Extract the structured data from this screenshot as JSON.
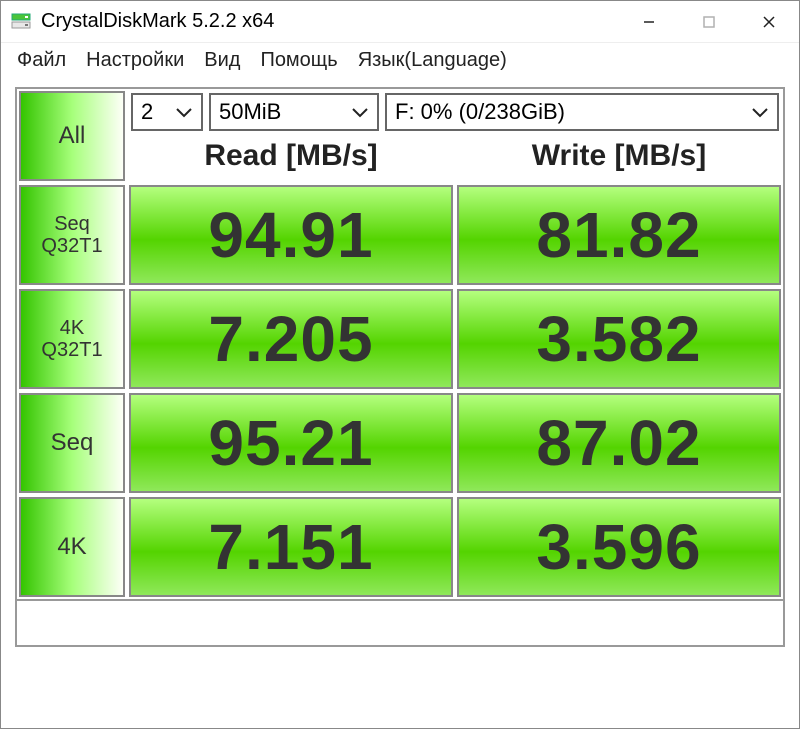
{
  "titlebar": {
    "title": "CrystalDiskMark 5.2.2 x64"
  },
  "menu": {
    "file": "Файл",
    "settings": "Настройки",
    "view": "Вид",
    "help": "Помощь",
    "language": "Язык(Language)"
  },
  "controls": {
    "all_label": "All",
    "runs": "2",
    "size": "50MiB",
    "drive": "F: 0% (0/238GiB)"
  },
  "headers": {
    "read": "Read [MB/s]",
    "write": "Write [MB/s]"
  },
  "rows": {
    "seq_q32t1": {
      "label_l1": "Seq",
      "label_l2": "Q32T1",
      "read": "94.91",
      "write": "81.82"
    },
    "four_k_q32t1": {
      "label_l1": "4K",
      "label_l2": "Q32T1",
      "read": "7.205",
      "write": "3.582"
    },
    "seq": {
      "label": "Seq",
      "read": "95.21",
      "write": "87.02"
    },
    "four_k": {
      "label": "4K",
      "read": "7.151",
      "write": "3.596"
    }
  },
  "status": ""
}
